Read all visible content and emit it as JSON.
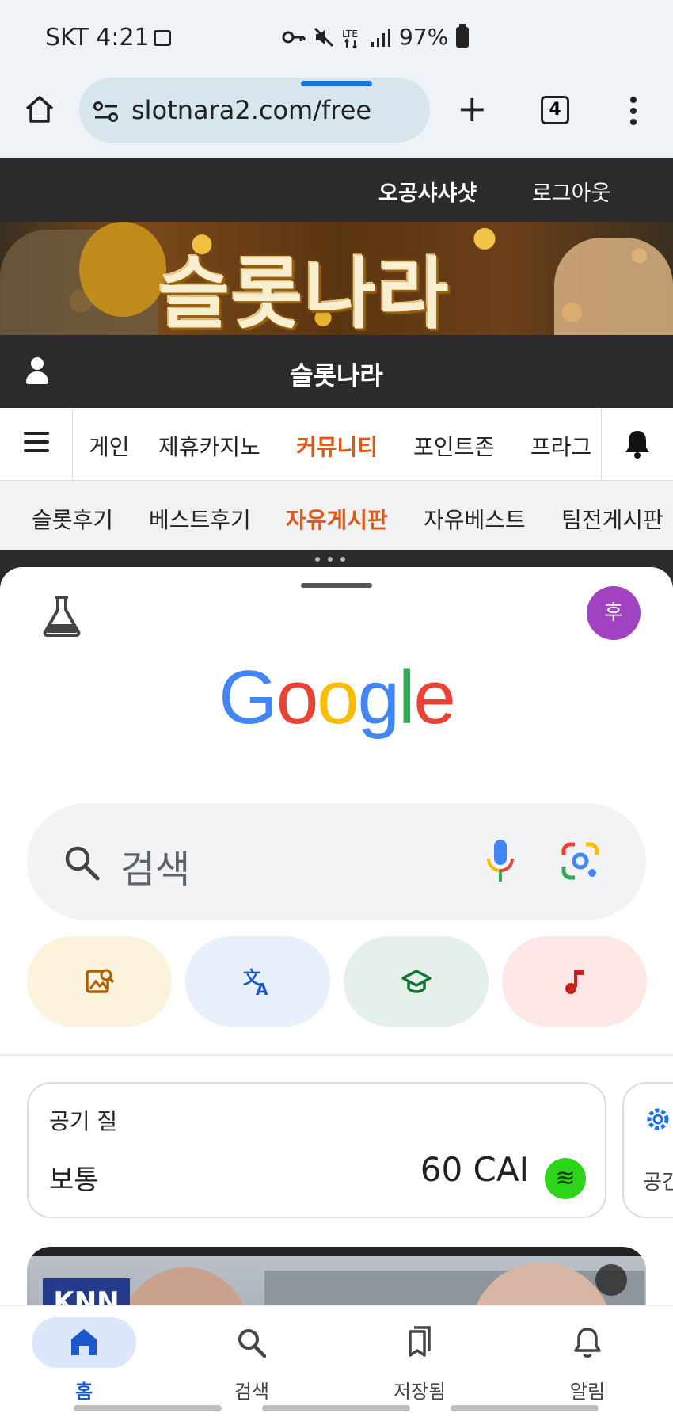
{
  "status_bar": {
    "carrier_time": "SKT 4:21",
    "battery": "97%",
    "icons": [
      "gallery-icon",
      "key-icon",
      "mute-icon",
      "lte-icon",
      "signal-icon",
      "battery-icon"
    ]
  },
  "browser": {
    "url": "slotnara2.com/free",
    "tab_count": "4",
    "icons": [
      "home-icon",
      "site-settings-icon",
      "new-tab-icon",
      "tab-switcher-icon",
      "menu-icon"
    ]
  },
  "site": {
    "username": "오공샤샤샷",
    "logout": "로그아웃",
    "banner_title": "슬롯나라",
    "site_name": "슬롯나라",
    "nav_items": [
      {
        "label": "게인",
        "active": false
      },
      {
        "label": "제휴카지노",
        "active": false
      },
      {
        "label": "커뮤니티",
        "active": true
      },
      {
        "label": "포인트존",
        "active": false
      },
      {
        "label": "프라그",
        "active": false
      }
    ],
    "sub_items": [
      {
        "label": "슬롯후기",
        "active": false
      },
      {
        "label": "베스트후기",
        "active": false
      },
      {
        "label": "자유게시판",
        "active": true
      },
      {
        "label": "자유베스트",
        "active": false
      },
      {
        "label": "팀전게시판",
        "active": false
      }
    ]
  },
  "google": {
    "avatar_letter": "후",
    "logo": [
      "G",
      "o",
      "o",
      "g",
      "l",
      "e"
    ],
    "logo_colors": [
      "#4285F4",
      "#EA4335",
      "#FBBC05",
      "#4285F4",
      "#34A853",
      "#EA4335"
    ],
    "search_placeholder": "검색",
    "chips": [
      {
        "name": "image-search",
        "color": "#fbf3dc",
        "icon_color": "#b06000"
      },
      {
        "name": "translate",
        "color": "#e8effd",
        "icon_color": "#1a57c8"
      },
      {
        "name": "homework",
        "color": "#e6f0ea",
        "icon_color": "#137333"
      },
      {
        "name": "song-search",
        "color": "#fde7e7",
        "icon_color": "#c5221f"
      }
    ],
    "air_quality": {
      "label": "공기 질",
      "status": "보통",
      "value": "60 CAI",
      "indicator_color": "#2ed31b"
    },
    "next_card_text": "공간",
    "news_logo": "KNN"
  },
  "bottom_nav": [
    {
      "label": "홈",
      "active": true
    },
    {
      "label": "검색",
      "active": false
    },
    {
      "label": "저장됨",
      "active": false
    },
    {
      "label": "알림",
      "active": false
    }
  ]
}
